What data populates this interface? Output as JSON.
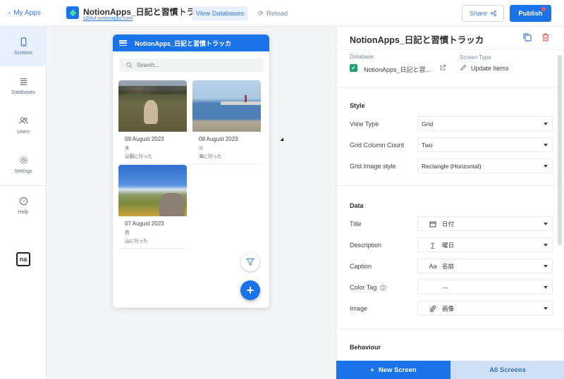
{
  "topbar": {
    "back_label": "My Apps",
    "app_title": "NotionApps_日記と習慣トラ...",
    "app_url": "s2f4vf.notionapps.com",
    "view_databases_label": "View Databases",
    "reload_label": "Reload",
    "share_label": "Share",
    "publish_label": "Publish"
  },
  "sidebar": {
    "items": [
      {
        "label": "Screens",
        "icon": "phone-icon"
      },
      {
        "label": "Databases",
        "icon": "list-icon"
      },
      {
        "label": "Users",
        "icon": "users-icon"
      },
      {
        "label": "Settings",
        "icon": "gear-icon"
      },
      {
        "label": "Help",
        "icon": "help-icon"
      }
    ],
    "logo_text": "na"
  },
  "phone": {
    "title": "NotionApps_日記と習慣トラッカ",
    "search_placeholder": "Search...",
    "cards": [
      {
        "date": "09 August 2023",
        "description": "水",
        "caption": "公園に行った"
      },
      {
        "date": "08 August 2023",
        "description": "火",
        "caption": "海に行った"
      },
      {
        "date": "07 August 2023",
        "description": "月",
        "caption": "山に行った"
      }
    ],
    "add_symbol": "+"
  },
  "panel": {
    "title": "NotionApps_日記と習慣トラッカ",
    "database_label": "Database",
    "database_name": "NotionApps_日記と習...",
    "screen_type_label": "Screen Type",
    "screen_type_value": "Update Items",
    "style_heading": "Style",
    "style_rows": [
      {
        "label": "View Type",
        "value": "Grid"
      },
      {
        "label": "Grid Column Count",
        "value": "Two"
      },
      {
        "label": "Grid Image style",
        "value": "Rectangle (Horizontal)"
      }
    ],
    "data_heading": "Data",
    "data_rows": [
      {
        "label": "Title",
        "icon": "calendar-icon",
        "value": "日付"
      },
      {
        "label": "Description",
        "icon": "sigma-icon",
        "icon_text": "∑",
        "value": "曜日"
      },
      {
        "label": "Caption",
        "icon": "text-icon",
        "icon_text": "Aa",
        "value": "名前"
      },
      {
        "label": "Color Tag",
        "icon": "",
        "value": "---"
      },
      {
        "label": "Image",
        "icon": "paperclip-icon",
        "value": "画像"
      }
    ],
    "behaviour_heading": "Behaviour",
    "new_screen_label": "New Screen",
    "all_screens_label": "All Screens"
  },
  "colors": {
    "accent": "#1a73e8",
    "accent_light": "#e8f0fb",
    "check_green": "#22a06b"
  }
}
